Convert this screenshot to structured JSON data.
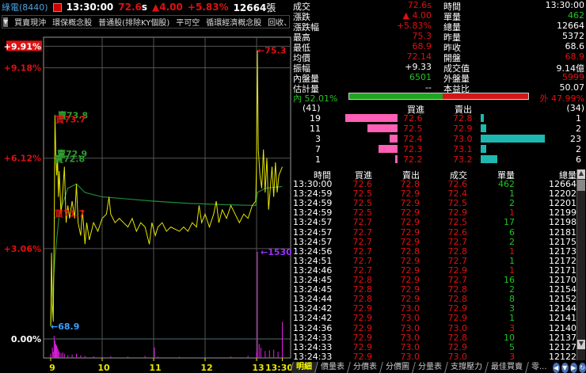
{
  "header": {
    "stock": "綠電(8440)",
    "time": "13:30:00",
    "price": "72.6",
    "price_flag": "s",
    "change": "▲4.00",
    "change_pct": "+5.83%",
    "volume": "12664",
    "volume_unit": "張"
  },
  "categories": [
    "買賣現沖",
    "環保概念股",
    "普通股(排除KY個股)",
    "平可空",
    "循環經濟概念股",
    "回收、..."
  ],
  "quote": [
    {
      "l1": "成交",
      "v1": "72.6s",
      "c1": "red",
      "l2": "時間",
      "v2": "13:30:00",
      "c2": "white"
    },
    {
      "l1": "漲跌",
      "v1": "▲ 4.00",
      "c1": "red",
      "l2": "單量",
      "v2": "462",
      "c2": "green"
    },
    {
      "l1": "漲跌幅",
      "v1": "+5.83%",
      "c1": "red",
      "l2": "總量",
      "v2": "12664",
      "c2": "white"
    },
    {
      "l1": "最高",
      "v1": "75.3",
      "c1": "red",
      "l2": "昨量",
      "v2": "5372",
      "c2": "white"
    },
    {
      "l1": "最低",
      "v1": "68.9",
      "c1": "red",
      "l2": "昨收",
      "v2": "68.6",
      "c2": "white"
    },
    {
      "l1": "均價",
      "v1": "72.14",
      "c1": "red",
      "l2": "開盤",
      "v2": "68.9",
      "c2": "red"
    },
    {
      "l1": "振幅",
      "v1": "+9.33",
      "c1": "white",
      "l2": "成交值",
      "v2": "9.14億",
      "c2": "white"
    },
    {
      "l1": "內盤量",
      "v1": "6501",
      "c1": "green",
      "l2": "外盤量",
      "v2": "5999",
      "c2": "red"
    },
    {
      "l1": "估計量",
      "v1": "--",
      "c1": "white",
      "l2": "本益比",
      "v2": "50.07",
      "c2": "white"
    }
  ],
  "inout": {
    "in_label": "內 52.01%",
    "out_label": "外 47.99%",
    "in_pct": 52.01
  },
  "orderbook": {
    "bid_total": "(41)",
    "ask_total": "(34)",
    "bid_header": "買進",
    "ask_header": "賣出",
    "rows": [
      {
        "bid_qty": 19,
        "bid": "72.6",
        "ask": "72.8",
        "ask_qty": 1
      },
      {
        "bid_qty": 11,
        "bid": "72.5",
        "ask": "72.9",
        "ask_qty": 2
      },
      {
        "bid_qty": 3,
        "bid": "72.4",
        "ask": "73.0",
        "ask_qty": 23
      },
      {
        "bid_qty": 7,
        "bid": "72.3",
        "ask": "73.1",
        "ask_qty": 2
      },
      {
        "bid_qty": 1,
        "bid": "72.2",
        "ask": "73.2",
        "ask_qty": 6
      }
    ]
  },
  "ticks": {
    "headers": [
      "時間",
      "買進",
      "賣出",
      "成交",
      "單量",
      "總量"
    ],
    "rows": [
      [
        "13:30:00",
        "72.6",
        "72.8",
        "72.6",
        "462",
        "12664",
        "green"
      ],
      [
        "13:24:59",
        "72.5",
        "72.9",
        "72.4",
        "1",
        "12202",
        "green"
      ],
      [
        "13:24:59",
        "72.5",
        "72.9",
        "72.5",
        "2",
        "12201",
        "green"
      ],
      [
        "13:24:59",
        "72.5",
        "72.9",
        "72.9",
        "1",
        "12199",
        "red"
      ],
      [
        "13:24:57",
        "72.7",
        "72.9",
        "72.5",
        "17",
        "12198",
        "green"
      ],
      [
        "13:24:57",
        "72.7",
        "72.9",
        "72.6",
        "6",
        "12181",
        "green"
      ],
      [
        "13:24:57",
        "72.7",
        "72.9",
        "72.7",
        "2",
        "12175",
        "green"
      ],
      [
        "13:24:56",
        "72.7",
        "72.8",
        "72.8",
        "1",
        "12173",
        "red"
      ],
      [
        "13:24:51",
        "72.7",
        "72.9",
        "72.7",
        "1",
        "12172",
        "green"
      ],
      [
        "13:24:46",
        "72.7",
        "72.9",
        "72.9",
        "1",
        "12171",
        "red"
      ],
      [
        "13:24:45",
        "72.8",
        "72.9",
        "72.7",
        "16",
        "12170",
        "green"
      ],
      [
        "13:24:45",
        "72.8",
        "72.9",
        "72.8",
        "2",
        "12154",
        "green"
      ],
      [
        "13:24:44",
        "72.8",
        "72.9",
        "72.8",
        "8",
        "12152",
        "green"
      ],
      [
        "13:24:42",
        "72.9",
        "73.0",
        "72.9",
        "3",
        "12144",
        "green"
      ],
      [
        "13:24:42",
        "72.9",
        "73.0",
        "72.9",
        "1",
        "12141",
        "green"
      ],
      [
        "13:24:36",
        "72.9",
        "73.0",
        "73.0",
        "3",
        "12140",
        "red"
      ],
      [
        "13:24:33",
        "72.9",
        "73.0",
        "72.8",
        "10",
        "12137",
        "green"
      ],
      [
        "13:24:33",
        "72.9",
        "73.0",
        "72.9",
        "5",
        "12127",
        "green"
      ],
      [
        "13:24:33",
        "72.9",
        "73.0",
        "73.0",
        "3",
        "12122",
        "red"
      ]
    ]
  },
  "tabs": [
    "明細",
    "價量表",
    "分價表",
    "分價圖",
    "分量表",
    "支撐壓力",
    "最佳買賣",
    "零..."
  ],
  "chart_data": {
    "type": "line",
    "prev_close": 68.6,
    "y_pct_ticks": [
      "+9.91%",
      "+9.18%",
      "+6.12%",
      "+3.06%",
      "0.00%"
    ],
    "y_pct_values": [
      9.91,
      9.18,
      6.12,
      3.06,
      0
    ],
    "x_ticks": [
      "9",
      "10",
      "11",
      "12",
      "13",
      "13:30"
    ],
    "x_tick_minutes": [
      0,
      60,
      120,
      180,
      240,
      270
    ],
    "price_series": [
      [
        0,
        68.9
      ],
      [
        1,
        70.6
      ],
      [
        2,
        69.4
      ],
      [
        3,
        69.0
      ],
      [
        4,
        70.9
      ],
      [
        5,
        73.8
      ],
      [
        6,
        72.9
      ],
      [
        7,
        72.4
      ],
      [
        8,
        72.8
      ],
      [
        9,
        71.9
      ],
      [
        10,
        72.5
      ],
      [
        12,
        71.5
      ],
      [
        14,
        72.0
      ],
      [
        16,
        72.6
      ],
      [
        18,
        71.3
      ],
      [
        20,
        71.7
      ],
      [
        22,
        71.4
      ],
      [
        25,
        71.8
      ],
      [
        28,
        71.4
      ],
      [
        30,
        72.2
      ],
      [
        32,
        71.3
      ],
      [
        35,
        71.0
      ],
      [
        37,
        71.6
      ],
      [
        40,
        70.8
      ],
      [
        42,
        71.3
      ],
      [
        45,
        70.9
      ],
      [
        50,
        71.3
      ],
      [
        55,
        71.1
      ],
      [
        60,
        71.4
      ],
      [
        65,
        71.5
      ],
      [
        68,
        71.9
      ],
      [
        70,
        71.5
      ],
      [
        75,
        71.3
      ],
      [
        80,
        71.4
      ],
      [
        85,
        71.3
      ],
      [
        90,
        71.2
      ],
      [
        95,
        71.4
      ],
      [
        100,
        71.1
      ],
      [
        105,
        71.3
      ],
      [
        110,
        71.2
      ],
      [
        115,
        70.8
      ],
      [
        118,
        71.3
      ],
      [
        122,
        71.0
      ],
      [
        125,
        71.2
      ],
      [
        130,
        71.3
      ],
      [
        135,
        71.1
      ],
      [
        140,
        71.2
      ],
      [
        150,
        71.1
      ],
      [
        155,
        71.2
      ],
      [
        160,
        71.1
      ],
      [
        165,
        71.3
      ],
      [
        170,
        71.2
      ],
      [
        173,
        71.7
      ],
      [
        176,
        71.3
      ],
      [
        180,
        71.5
      ],
      [
        185,
        71.2
      ],
      [
        190,
        71.5
      ],
      [
        193,
        71.8
      ],
      [
        196,
        71.3
      ],
      [
        200,
        71.6
      ],
      [
        205,
        71.4
      ],
      [
        210,
        71.7
      ],
      [
        215,
        71.5
      ],
      [
        220,
        71.3
      ],
      [
        225,
        71.5
      ],
      [
        230,
        71.4
      ],
      [
        235,
        71.7
      ],
      [
        239,
        71.8
      ],
      [
        240,
        72.7
      ],
      [
        241,
        75.3
      ],
      [
        242,
        73.0
      ],
      [
        244,
        72.4
      ],
      [
        246,
        72.1
      ],
      [
        248,
        73.0
      ],
      [
        250,
        72.0
      ],
      [
        252,
        72.8
      ],
      [
        254,
        71.6
      ],
      [
        256,
        72.1
      ],
      [
        258,
        72.6
      ],
      [
        260,
        71.9
      ],
      [
        262,
        72.7
      ],
      [
        264,
        72.0
      ],
      [
        266,
        72.4
      ],
      [
        270,
        72.6
      ]
    ],
    "avg_series": [
      [
        0,
        68.9
      ],
      [
        5,
        70.5
      ],
      [
        10,
        71.5
      ],
      [
        20,
        72.1
      ],
      [
        30,
        72.2
      ],
      [
        40,
        72.0
      ],
      [
        60,
        71.9
      ],
      [
        90,
        71.85
      ],
      [
        120,
        71.8
      ],
      [
        160,
        71.75
      ],
      [
        200,
        71.72
      ],
      [
        239,
        71.7
      ],
      [
        241,
        72.0
      ],
      [
        250,
        72.1
      ],
      [
        270,
        72.14
      ]
    ],
    "volume_series": [
      [
        0,
        60
      ],
      [
        2,
        150
      ],
      [
        3,
        90
      ],
      [
        4,
        320
      ],
      [
        5,
        250
      ],
      [
        6,
        200
      ],
      [
        7,
        180
      ],
      [
        8,
        150
      ],
      [
        9,
        120
      ],
      [
        10,
        90
      ],
      [
        12,
        70
      ],
      [
        14,
        80
      ],
      [
        16,
        60
      ],
      [
        20,
        40
      ],
      [
        25,
        50
      ],
      [
        30,
        60
      ],
      [
        35,
        40
      ],
      [
        40,
        30
      ],
      [
        50,
        25
      ],
      [
        60,
        20
      ],
      [
        70,
        25
      ],
      [
        90,
        20
      ],
      [
        110,
        30
      ],
      [
        121,
        150
      ],
      [
        125,
        20
      ],
      [
        150,
        15
      ],
      [
        180,
        15
      ],
      [
        210,
        20
      ],
      [
        230,
        30
      ],
      [
        240,
        80
      ],
      [
        241,
        1530
      ],
      [
        243,
        200
      ],
      [
        245,
        150
      ],
      [
        250,
        100
      ],
      [
        255,
        110
      ],
      [
        260,
        120
      ],
      [
        265,
        90
      ],
      [
        270,
        520
      ]
    ],
    "annotations": [
      {
        "text": "賣73.8",
        "color": "#2e9c2e"
      },
      {
        "text": "買73.7",
        "color": "#e01010"
      },
      {
        "text": "賣72.9",
        "color": "#2e9c2e"
      },
      {
        "text": "賣72.8",
        "color": "#2e9c2e"
      },
      {
        "text": "買71.7",
        "color": "#e01010"
      },
      {
        "text": "←75.3",
        "color": "#e01010"
      },
      {
        "text": "←68.9",
        "color": "#3aa0ff"
      },
      {
        "text": "←1530",
        "color": "#9a30ff"
      }
    ],
    "colors": {
      "price": "#e6e600",
      "avg": "#1f8a3a",
      "volume": "#e020e0",
      "grid": "#555"
    }
  }
}
